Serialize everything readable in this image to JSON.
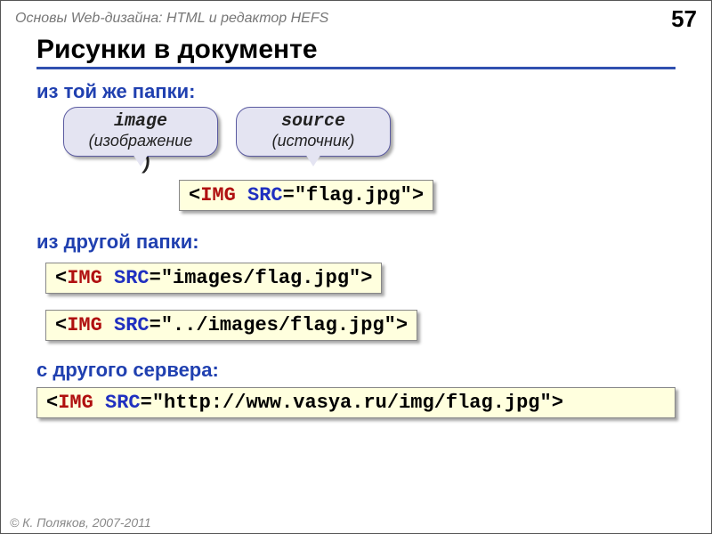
{
  "header": {
    "course_title": "Основы Web-дизайна: HTML и редактор HEFS",
    "slide_number": "57"
  },
  "title": "Рисунки в документе",
  "section1": {
    "label": "из той же папки:",
    "callouts": [
      {
        "word": "image",
        "meaning": "(изображение"
      },
      {
        "word": "source",
        "meaning": "(источник)"
      }
    ],
    "close_paren": ")",
    "code": {
      "open_bracket": "<",
      "tag": "IMG",
      "space": " ",
      "attr": "SRC",
      "rest": "=\"flag.jpg\">"
    }
  },
  "section2": {
    "label": "из другой папки:",
    "code1": {
      "open_bracket": "<",
      "tag": "IMG",
      "space": " ",
      "attr": "SRC",
      "rest": "=\"images/flag.jpg\">"
    },
    "code2": {
      "open_bracket": "<",
      "tag": "IMG",
      "space": " ",
      "attr": "SRC",
      "rest": "=\"../images/flag.jpg\">"
    }
  },
  "section3": {
    "label": "с другого сервера:",
    "code": {
      "open_bracket": "<",
      "tag": "IMG",
      "space": " ",
      "attr": "SRC",
      "rest": "=\"http://www.vasya.ru/img/flag.jpg\">"
    }
  },
  "footer": {
    "copyright_symbol": "©",
    "text": " К. Поляков, 2007-2011"
  }
}
